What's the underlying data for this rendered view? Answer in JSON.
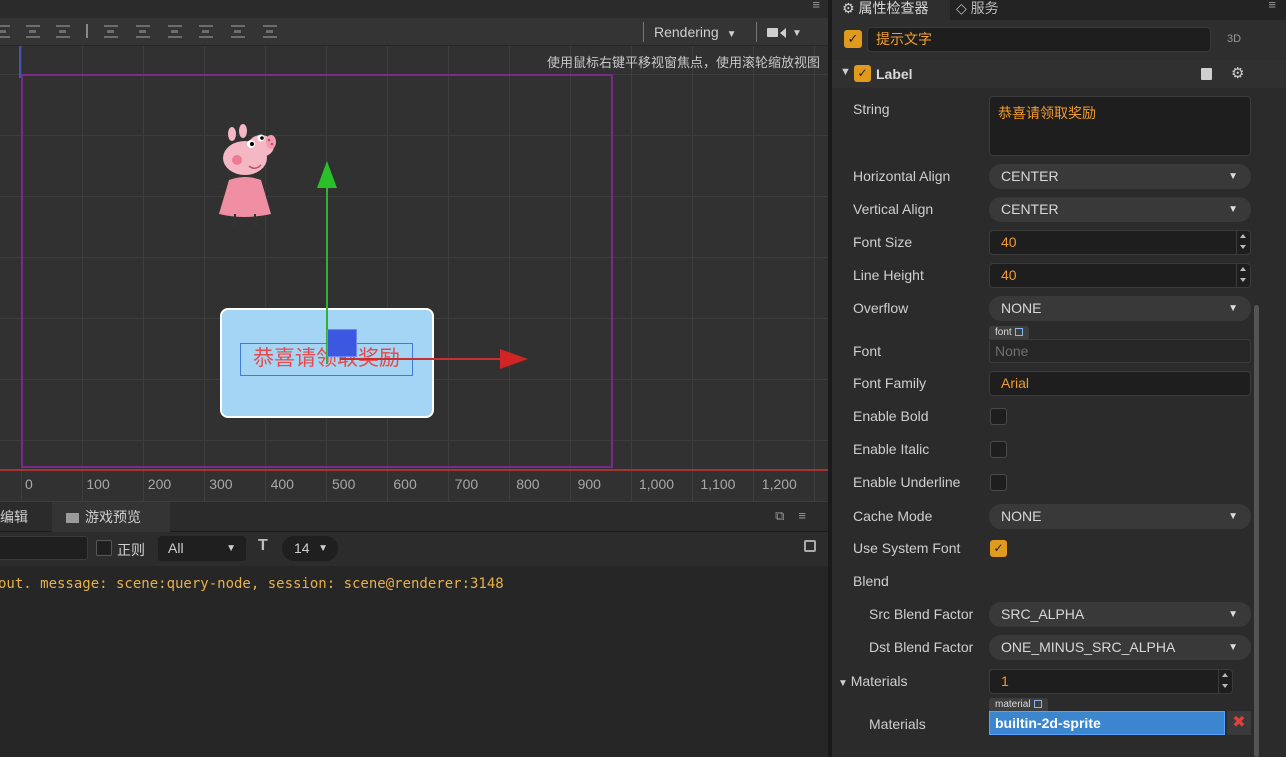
{
  "scene": {
    "menu_icon": "≡",
    "rendering_label": "Rendering",
    "hint": "使用鼠标右键平移视窗焦点，使用滚轮缩放视图",
    "ruler_ticks": [
      "0",
      "100",
      "200",
      "300",
      "400",
      "500",
      "600",
      "700",
      "800",
      "900",
      "1,000",
      "1,100",
      "1,200"
    ],
    "label_text": "恭喜请领取奖励",
    "colors": {
      "gizmo_x": "#d12424",
      "gizmo_y": "#29c029",
      "gizmo_center": "#3d58e0",
      "design_rect": "#7c2a8a",
      "label_bg": "#a4d5f4",
      "label_text": "#e64a4a"
    }
  },
  "console": {
    "tab_editor": "编辑器",
    "tab_preview": "游戏预览",
    "regex_label": "正则",
    "level": "All",
    "font_size": "14",
    "log_line": "out. message: scene:query-node, session: scene@renderer:3148"
  },
  "inspector": {
    "tab_inspector": "属性检查器",
    "tab_service": "服务",
    "menu_icon": "≡",
    "node_name": "提示文字",
    "node_3d": "3D",
    "component_title": "Label",
    "accent": "#e09b1f",
    "props": {
      "string_label": "String",
      "string_value": "恭喜请领取奖励",
      "halign_label": "Horizontal Align",
      "halign_value": "CENTER",
      "valign_label": "Vertical Align",
      "valign_value": "CENTER",
      "fontsize_label": "Font Size",
      "fontsize_value": "40",
      "lineheight_label": "Line Height",
      "lineheight_value": "40",
      "overflow_label": "Overflow",
      "overflow_value": "NONE",
      "font_label": "Font",
      "font_badge": "font",
      "font_value": "None",
      "fontfamily_label": "Font Family",
      "fontfamily_value": "Arial",
      "bold_label": "Enable Bold",
      "italic_label": "Enable Italic",
      "underline_label": "Enable Underline",
      "cache_label": "Cache Mode",
      "cache_value": "NONE",
      "sysfont_label": "Use System Font",
      "blend_label": "Blend",
      "src_label": "Src Blend Factor",
      "src_value": "SRC_ALPHA",
      "dst_label": "Dst Blend Factor",
      "dst_value": "ONE_MINUS_SRC_ALPHA",
      "materials_label": "Materials",
      "materials_count": "1",
      "materials_item_label": "Materials",
      "material_badge": "material",
      "material_value": "builtin-2d-sprite"
    }
  }
}
